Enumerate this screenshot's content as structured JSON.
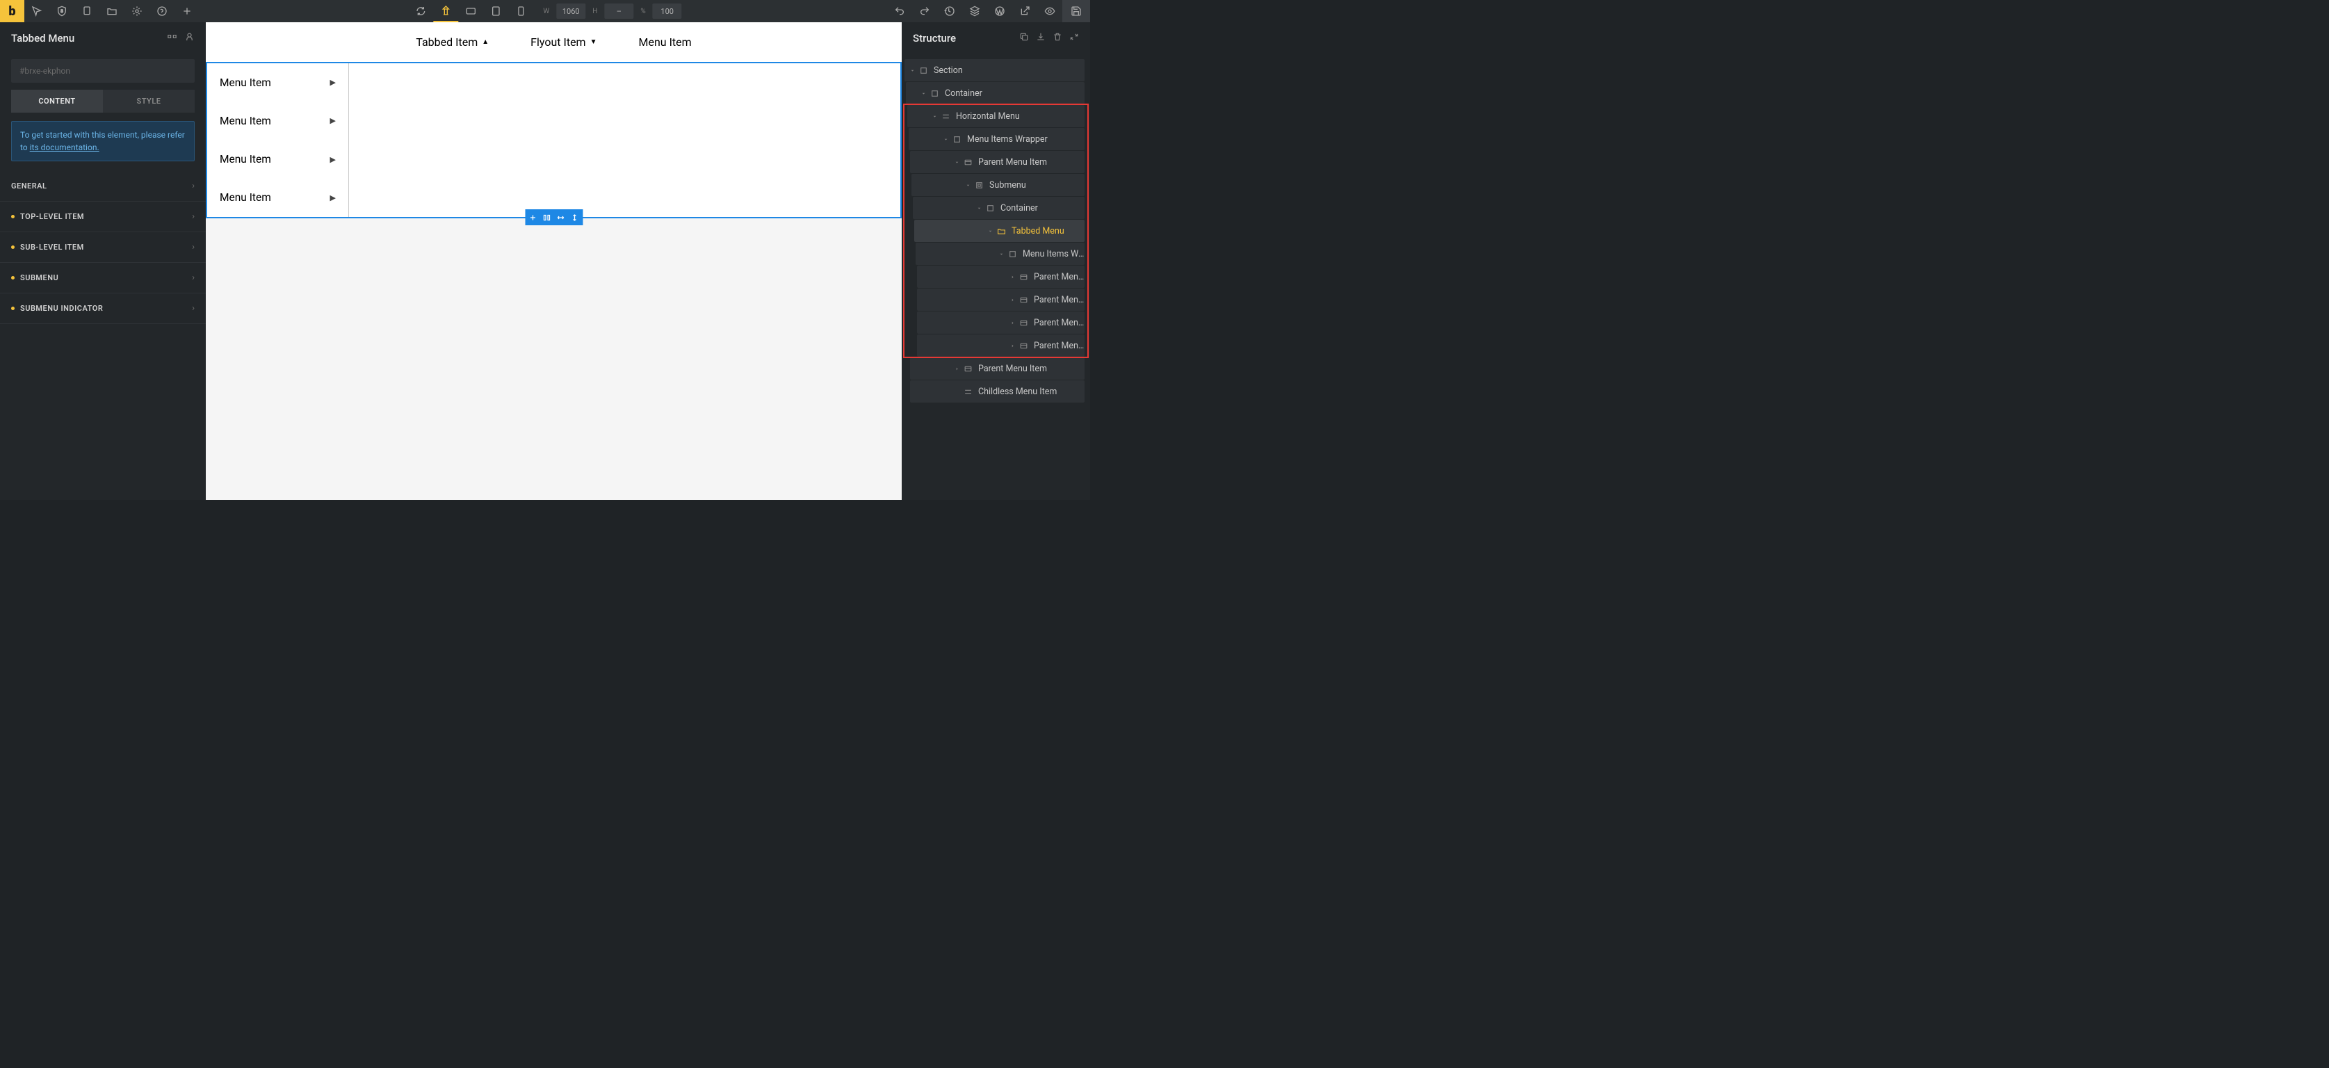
{
  "toolbar": {
    "width_label": "W",
    "width_value": "1060",
    "height_label": "H",
    "height_value": "–",
    "zoom_label": "%",
    "zoom_value": "100"
  },
  "left": {
    "title": "Tabbed Menu",
    "breadcrumb": "#brxe-ekphon",
    "tabs": {
      "content": "CONTENT",
      "style": "STYLE"
    },
    "info_prefix": "To get started with this element, please refer to ",
    "info_link": "its documentation.",
    "sections": [
      {
        "label": "GENERAL",
        "dot": false
      },
      {
        "label": "TOP-LEVEL ITEM",
        "dot": true
      },
      {
        "label": "SUB-LEVEL ITEM",
        "dot": true
      },
      {
        "label": "SUBMENU",
        "dot": true
      },
      {
        "label": "SUBMENU INDICATOR",
        "dot": true
      }
    ]
  },
  "canvas": {
    "nav": [
      {
        "label": "Tabbed Item",
        "caret": "up"
      },
      {
        "label": "Flyout Item",
        "caret": "down"
      },
      {
        "label": "Menu Item",
        "caret": null
      }
    ],
    "submenu_items": [
      "Menu Item",
      "Menu Item",
      "Menu Item",
      "Menu Item"
    ]
  },
  "right": {
    "title": "Structure",
    "tree": [
      {
        "depth": 0,
        "label": "Section",
        "icon": "square",
        "expanded": true,
        "bg": true
      },
      {
        "depth": 1,
        "label": "Container",
        "icon": "square",
        "expanded": true,
        "bg": true
      },
      {
        "depth": 2,
        "label": "Horizontal Menu",
        "icon": "menu",
        "expanded": true,
        "bg": true
      },
      {
        "depth": 3,
        "label": "Menu Items Wrapper",
        "icon": "square",
        "expanded": true,
        "bg": true
      },
      {
        "depth": 4,
        "label": "Parent Menu Item",
        "icon": "card",
        "expanded": true,
        "bg": true
      },
      {
        "depth": 5,
        "label": "Submenu",
        "icon": "submenu",
        "expanded": true,
        "bg": true
      },
      {
        "depth": 6,
        "label": "Container",
        "icon": "square",
        "expanded": true,
        "bg": true
      },
      {
        "depth": 7,
        "label": "Tabbed Menu",
        "icon": "folder",
        "expanded": true,
        "bg": true,
        "selected": true
      },
      {
        "depth": 8,
        "label": "Menu Items Wrapper",
        "icon": "square",
        "expanded": true,
        "bg": true,
        "truncated": true
      },
      {
        "depth": 9,
        "label": "Parent Menu Item",
        "icon": "card",
        "expanded": false,
        "bg": true,
        "truncated": true
      },
      {
        "depth": 9,
        "label": "Parent Menu Item",
        "icon": "card",
        "expanded": false,
        "bg": true,
        "truncated": true
      },
      {
        "depth": 9,
        "label": "Parent Menu Item",
        "icon": "card",
        "expanded": false,
        "bg": true,
        "truncated": true
      },
      {
        "depth": 9,
        "label": "Parent Menu Item",
        "icon": "card",
        "expanded": false,
        "bg": true,
        "truncated": true
      },
      {
        "depth": 4,
        "label": "Parent Menu Item",
        "icon": "card",
        "expanded": false,
        "bg": true
      },
      {
        "depth": 4,
        "label": "Childless Menu Item",
        "icon": "menu",
        "expanded": null,
        "bg": true
      }
    ]
  }
}
